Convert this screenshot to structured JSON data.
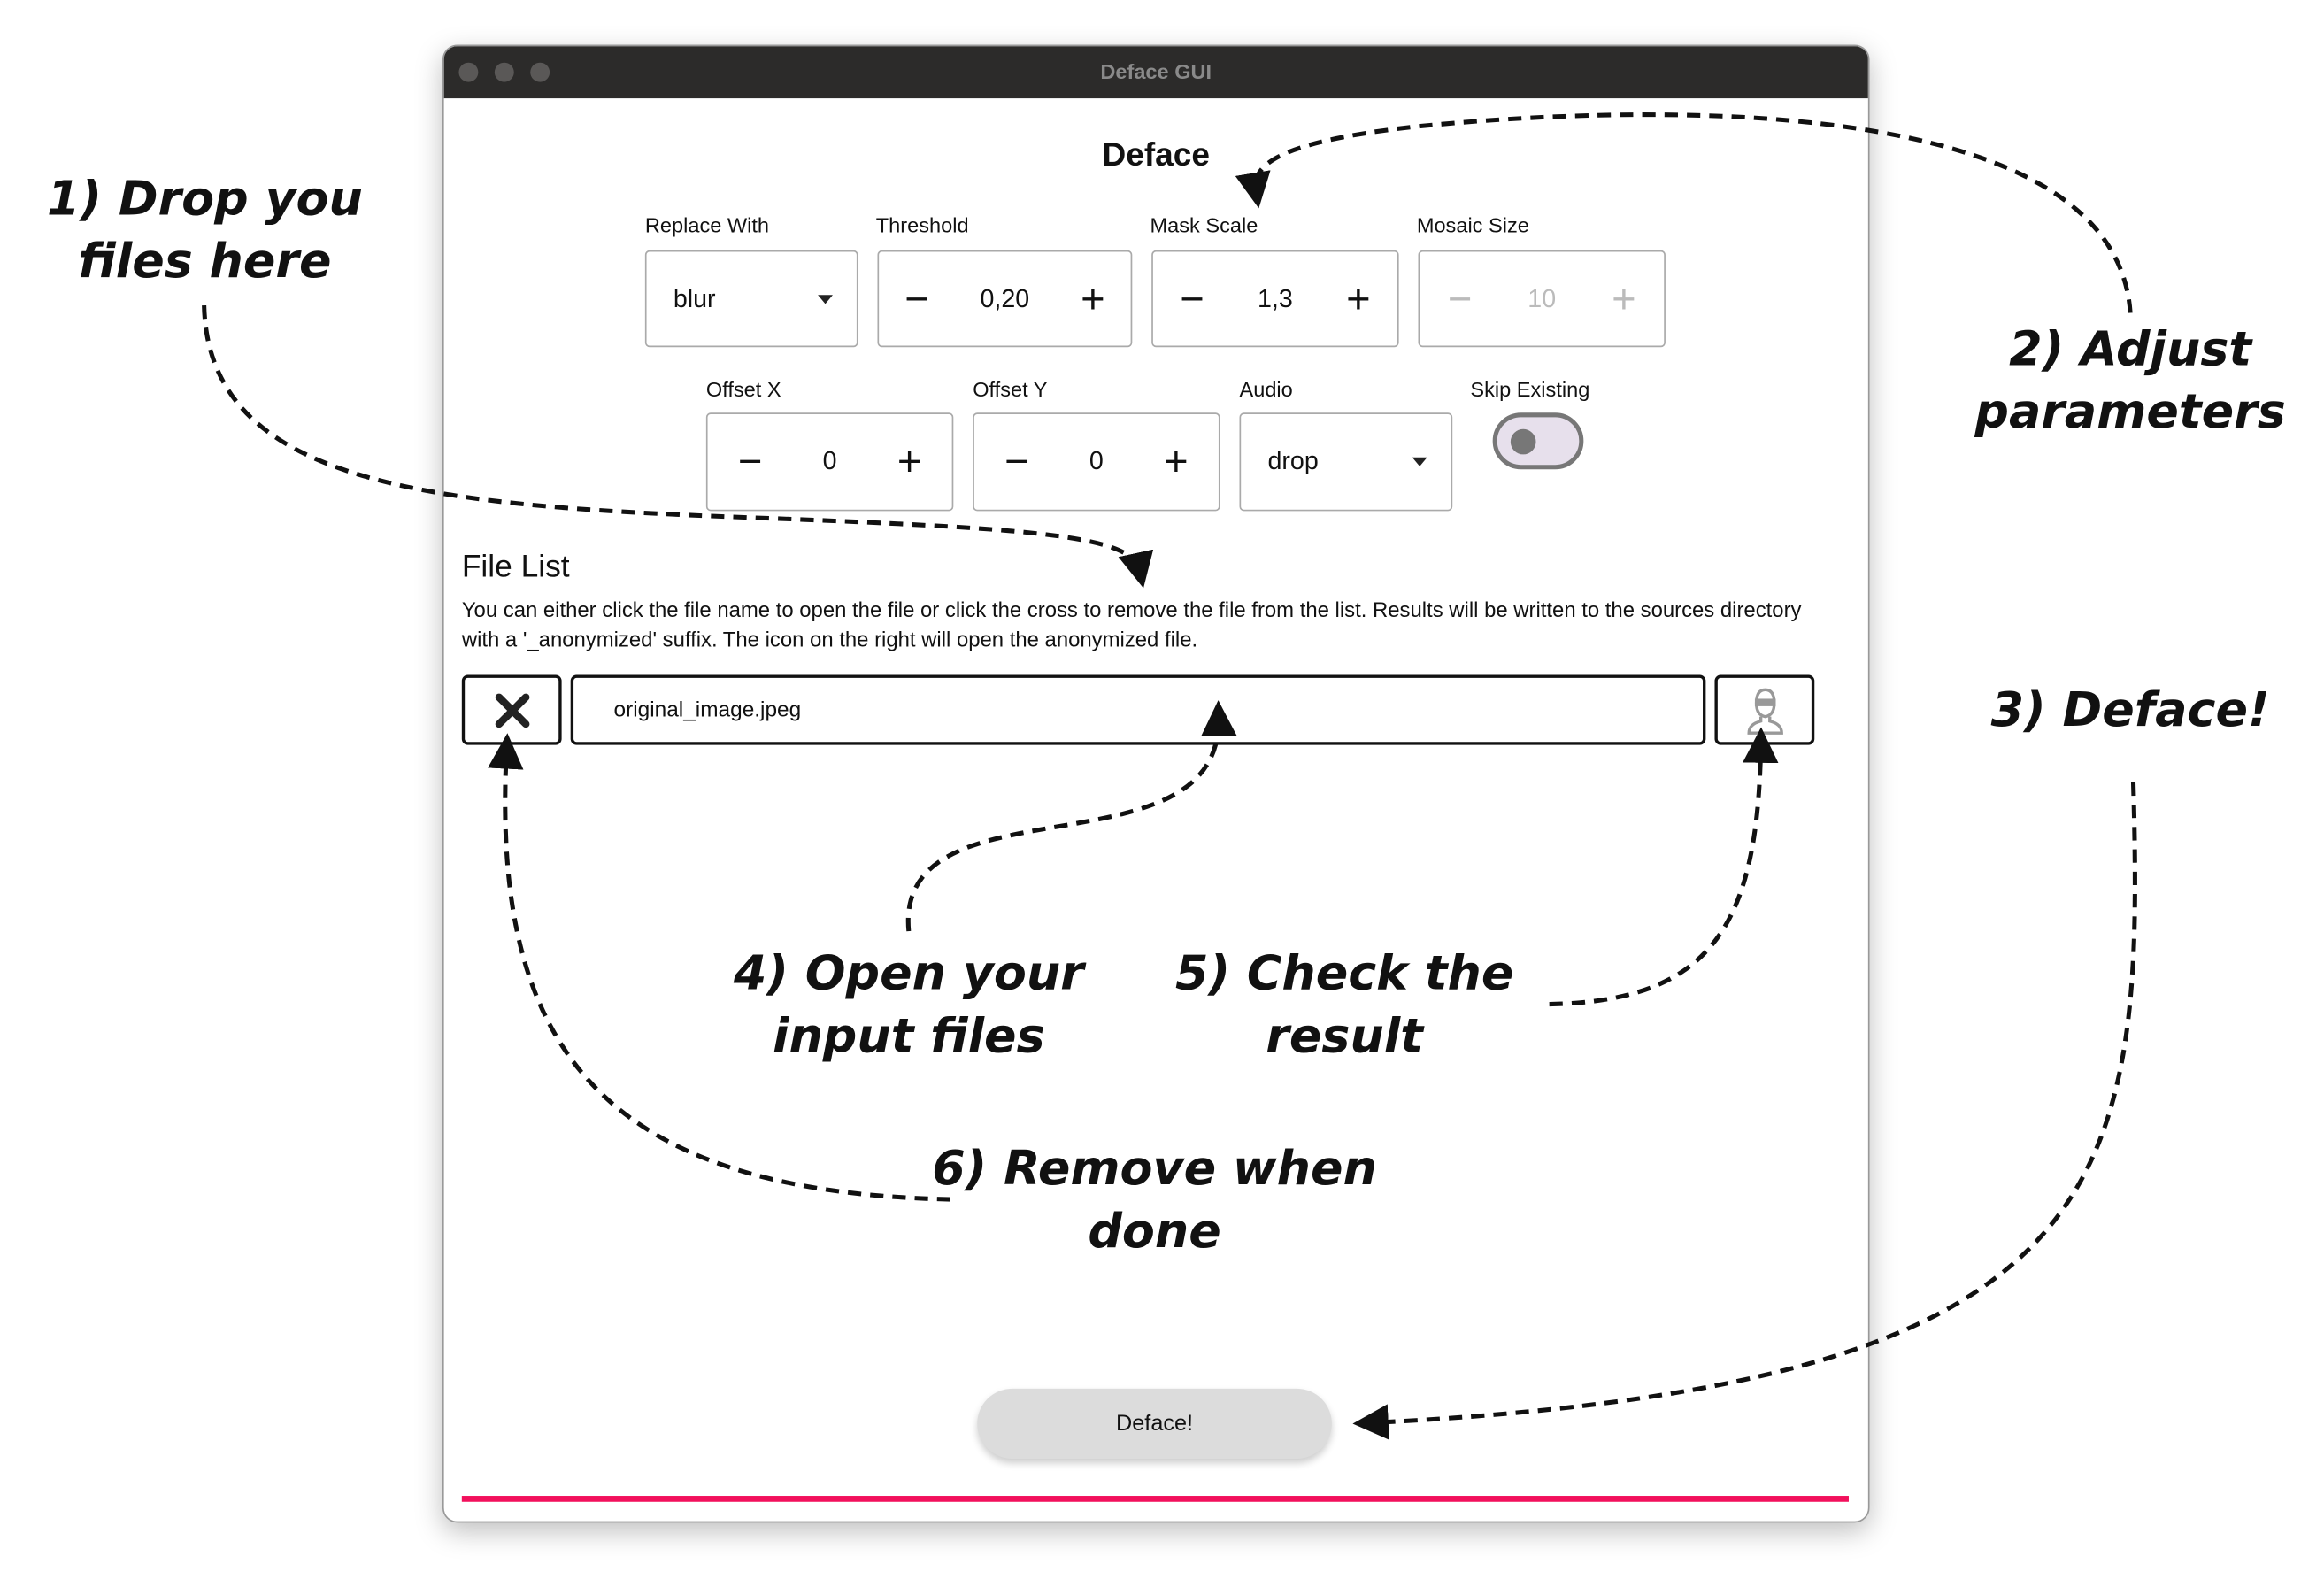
{
  "window": {
    "title": "Deface GUI"
  },
  "header": {
    "title": "Deface"
  },
  "params": {
    "replace_with": {
      "label": "Replace With",
      "value": "blur"
    },
    "threshold": {
      "label": "Threshold",
      "value": "0,20"
    },
    "mask_scale": {
      "label": "Mask Scale",
      "value": "1,3"
    },
    "mosaic_size": {
      "label": "Mosaic Size",
      "value": "10",
      "disabled": true
    },
    "offset_x": {
      "label": "Offset X",
      "value": "0"
    },
    "offset_y": {
      "label": "Offset Y",
      "value": "0"
    },
    "audio": {
      "label": "Audio",
      "value": "drop"
    },
    "skip_existing": {
      "label": "Skip Existing",
      "checked": false
    }
  },
  "file_list": {
    "title": "File List",
    "description": "You can either click the file name to open the file or click the cross to remove the file from the list. Results will be written to the sources directory with a '_anonymized' suffix. The icon on the right will open the anonymized file.",
    "files": [
      {
        "name": "original_image.jpeg"
      }
    ]
  },
  "actions": {
    "deface_label": "Deface!"
  },
  "progress": {
    "value": 1.0,
    "color": "#f2105c"
  },
  "annotations": {
    "a1": "1) Drop you\nfiles here",
    "a2": "2) Adjust\nparameters",
    "a3": "3) Deface!",
    "a4": "4) Open your\ninput files",
    "a5": "5) Check the\nresult",
    "a6": "6) Remove when\ndone"
  }
}
